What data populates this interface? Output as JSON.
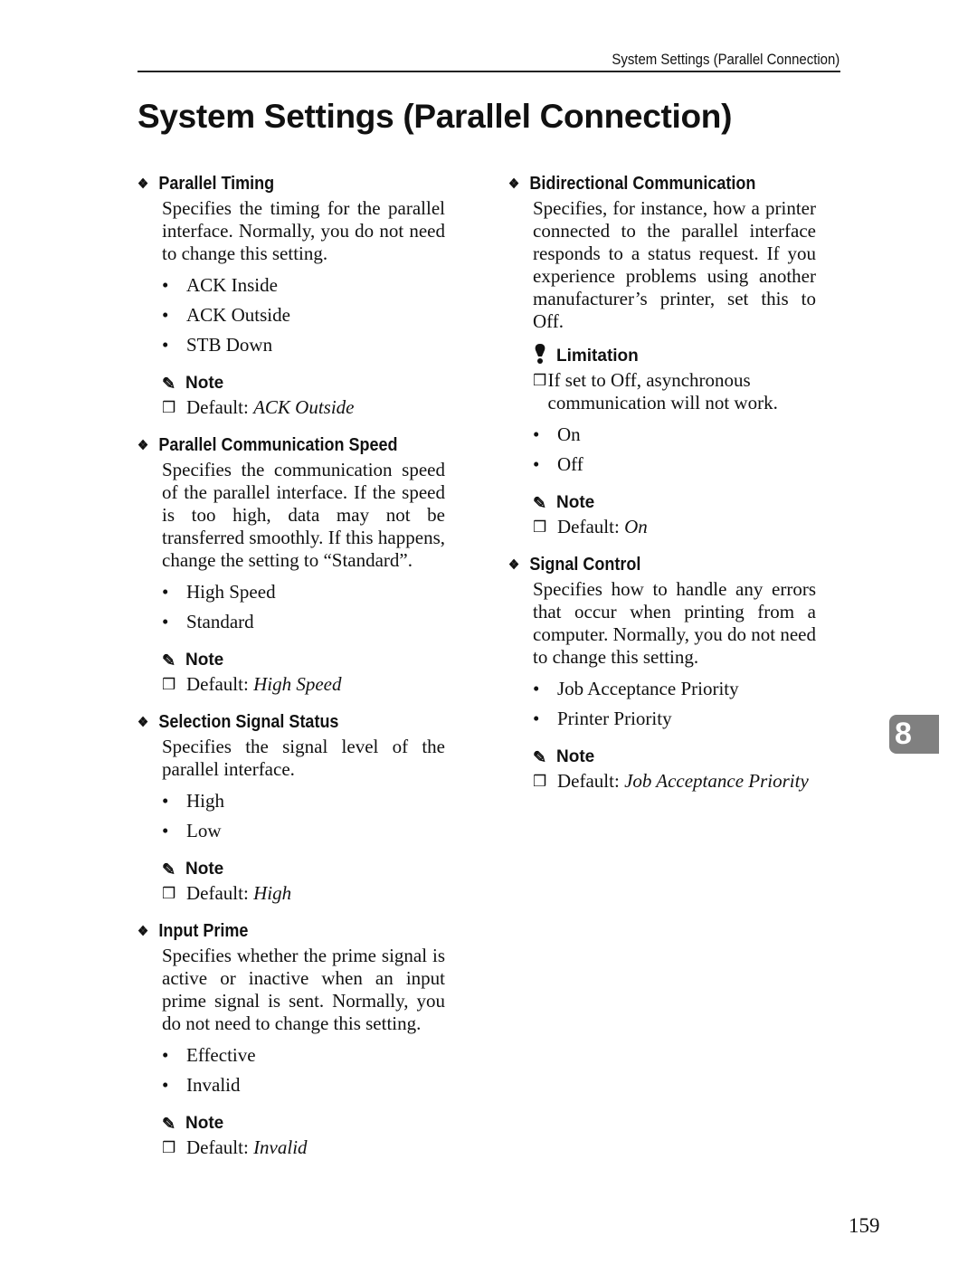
{
  "running_head": "System Settings (Parallel Connection)",
  "title": "System Settings (Parallel Connection)",
  "left_sections": [
    {
      "heading": "Parallel Timing",
      "body": "Specifies the timing for the parallel interface. Normally, you do not need to change this setting.",
      "options": [
        "ACK Inside",
        "ACK Outside",
        "STB Down"
      ],
      "note_label": "Note",
      "default_prefix": "Default: ",
      "default_value": "ACK Outside"
    },
    {
      "heading": "Parallel Communication Speed",
      "body": "Specifies the communication speed of the parallel interface. If the speed is too high, data may not be transferred smoothly. If this happens, change the setting to “Standard”.",
      "options": [
        "High Speed",
        "Standard"
      ],
      "note_label": "Note",
      "default_prefix": "Default: ",
      "default_value": "High Speed"
    },
    {
      "heading": "Selection Signal Status",
      "body": "Specifies the signal level of the parallel interface.",
      "options": [
        "High",
        "Low"
      ],
      "note_label": "Note",
      "default_prefix": "Default: ",
      "default_value": "High"
    },
    {
      "heading": "Input Prime",
      "body": "Specifies whether the prime signal is active or inactive when an input prime signal is sent. Normally, you do not need to change this setting.",
      "options": [
        "Effective",
        "Invalid"
      ],
      "note_label": "Note",
      "default_prefix": "Default: ",
      "default_value": "Invalid"
    }
  ],
  "right_sections": [
    {
      "heading": "Bidirectional Communication",
      "body": "Specifies, for instance, how a printer connected to the parallel interface responds to a status request. If you experience problems using another manufacturer’s printer, set this to Off.",
      "limitation_label": "Limitation",
      "limitation_text": "If set to Off, asynchronous communication will not work.",
      "options": [
        "On",
        "Off"
      ],
      "note_label": "Note",
      "default_prefix": "Default: ",
      "default_value": "On"
    },
    {
      "heading": "Signal Control",
      "body": "Specifies how to handle any errors that occur when printing from a computer. Normally, you do not need to change this setting.",
      "options": [
        "Job Acceptance Priority",
        "Printer Priority"
      ],
      "note_label": "Note",
      "default_prefix": "Default: ",
      "default_value": "Job Acceptance Priority"
    }
  ],
  "chapter_tab": "8",
  "page_number": "159"
}
